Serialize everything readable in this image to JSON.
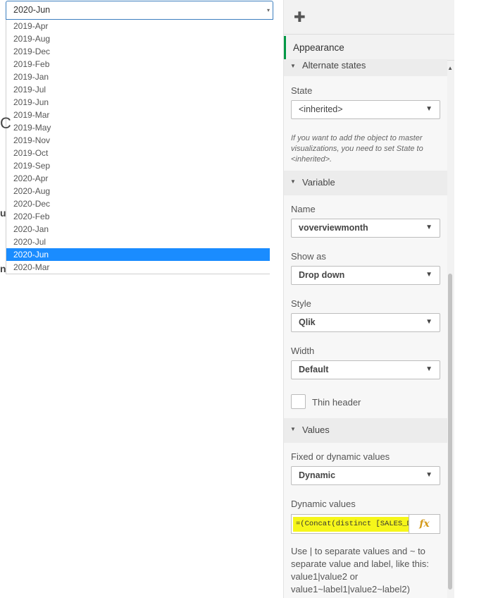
{
  "dropdown": {
    "selected": "2020-Jun",
    "options": [
      "2019-Apr",
      "2019-Aug",
      "2019-Dec",
      "2019-Feb",
      "2019-Jan",
      "2019-Jul",
      "2019-Jun",
      "2019-Mar",
      "2019-May",
      "2019-Nov",
      "2019-Oct",
      "2019-Sep",
      "2020-Apr",
      "2020-Aug",
      "2020-Dec",
      "2020-Feb",
      "2020-Jan",
      "2020-Jul",
      "2020-Jun",
      "2020-Mar"
    ],
    "highlighted": "2020-Jun"
  },
  "background_fragments": {
    "c": "C",
    "u": "u",
    "n": "n"
  },
  "panel": {
    "tab_label": "Appearance",
    "sections": {
      "alternate_states": "Alternate states",
      "variable": "Variable",
      "values": "Values"
    },
    "state": {
      "label": "State",
      "value": "<inherited>",
      "note": "If you want to add the object to master visualizations, you need to set State to <inherited>."
    },
    "name": {
      "label": "Name",
      "value": "voverviewmonth"
    },
    "show_as": {
      "label": "Show as",
      "value": "Drop down"
    },
    "style": {
      "label": "Style",
      "value": "Qlik"
    },
    "width": {
      "label": "Width",
      "value": "Default"
    },
    "thin_header": {
      "label": "Thin header",
      "checked": false
    },
    "fixed_dynamic": {
      "label": "Fixed or dynamic values",
      "value": "Dynamic"
    },
    "dynamic_values": {
      "label": "Dynamic values",
      "expression": "=(Concat(distinct [SALES_DA",
      "fx": "fx"
    },
    "help_text": "Use | to separate values and ~ to separate value and label, like this: value1|value2 or value1~label1|value2~label2)"
  },
  "colors": {
    "accent_green": "#009845",
    "selection_blue": "#1a8cff",
    "highlight_yellow": "#f6f61a"
  },
  "icons": {
    "extension": "puzzle-icon",
    "dropdown": "triangle-down-icon",
    "expression": "fx-icon"
  }
}
